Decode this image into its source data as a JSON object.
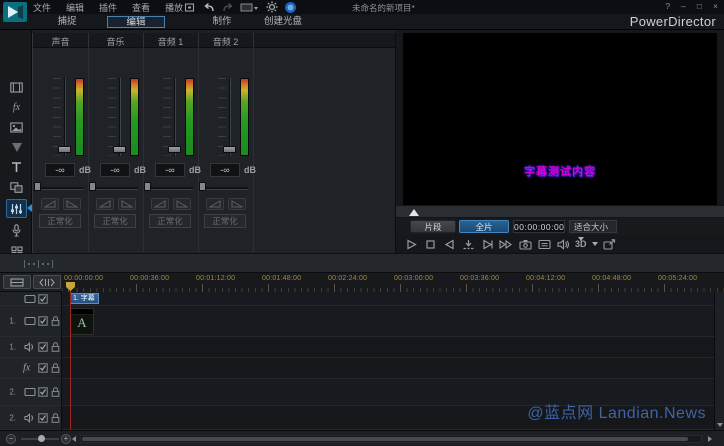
{
  "titlebar": {
    "menu_items": [
      "文件",
      "编辑",
      "插件",
      "查看",
      "播放"
    ],
    "menu_icon_names": [
      "select-mode-icon",
      "undo-icon",
      "redo-icon",
      "aspect-ratio-dropdown-icon",
      "settings-gear-icon",
      "cyberlink-account-icon"
    ],
    "project_title": "未命名的新项目*",
    "window_controls": {
      "help": "?",
      "minimize": "–",
      "maximize": "□",
      "close": "×"
    }
  },
  "mode_tabs": {
    "capture": "捕捉",
    "edit": "编辑",
    "produce": "制作",
    "create_disc": "创建光盘",
    "active_tab": "编辑",
    "brand": "PowerDirector"
  },
  "rooms": {
    "icon_names": [
      "media-room",
      "effect-room",
      "pip-objects-room",
      "particle-room",
      "title-room",
      "transition-room",
      "audio-mixing-room",
      "voice-over-room",
      "chapter-room",
      "subtitle-room"
    ],
    "active": "audio-mixing-room"
  },
  "mixer": {
    "channels": [
      {
        "name": "声音",
        "level": "-∞"
      },
      {
        "name": "音乐",
        "level": "-∞"
      },
      {
        "name": "音频 1",
        "level": "-∞"
      },
      {
        "name": "音频 2",
        "level": "-∞"
      }
    ],
    "unit": "dB",
    "normalize_label": "正常化"
  },
  "preview": {
    "subtitle_overlay": "字幕测试内容",
    "clip_button": "片段",
    "movie_button": "全片",
    "timecode": "00:00:00:00",
    "fit_select": "适合大小",
    "mode_3d": "3D",
    "transport_icon_names": [
      "play",
      "stop",
      "previous-frame",
      "jump-marker",
      "next-frame",
      "fast-forward",
      "snapshot",
      "preview-quality",
      "volume",
      "3d-mode",
      "undock-preview"
    ]
  },
  "timeline": {
    "ruler_labels": [
      "00:00:00:00",
      "00:00:36:00",
      "00:01:12:00",
      "00:01:48:00",
      "00:02:24:00",
      "00:03:00:00",
      "00:03:36:00",
      "00:04:12:00",
      "00:04:48:00",
      "00:05:24:00"
    ],
    "tracks": [
      {
        "label": "",
        "type": "video"
      },
      {
        "label": "1.",
        "type": "video"
      },
      {
        "label": "1.",
        "type": "audio"
      },
      {
        "label": "fx",
        "type": "effect"
      },
      {
        "label": "2.",
        "type": "video"
      },
      {
        "label": "2.",
        "type": "audio"
      }
    ],
    "title_clip_label": "1. 字幕",
    "video_clip_letter": "A",
    "toolbar_icon_names": [
      "track-manager",
      "range-select"
    ]
  },
  "watermark": "@蓝点网 Landian.News",
  "colors": {
    "accent_blue": "#2f6fa3",
    "subtitle_magenta": "#d400d4",
    "ruler_label": "#a8893c",
    "watermark_blue": "#3e63a6",
    "playhead_red": "#a42222",
    "meter_green": "#259a22"
  }
}
